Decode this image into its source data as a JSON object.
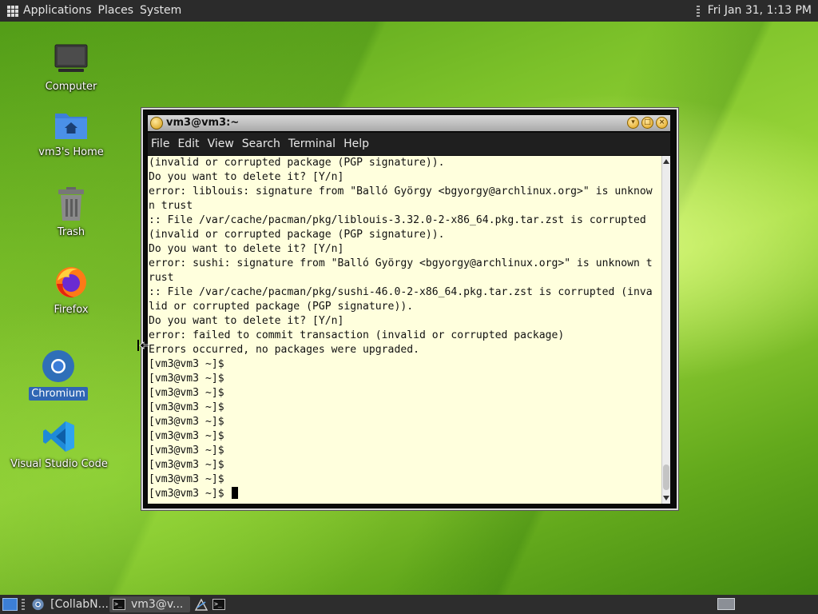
{
  "top_panel": {
    "menus": [
      "Applications",
      "Places",
      "System"
    ],
    "clock": "Fri Jan 31, 1:13 PM"
  },
  "desktop_icons": [
    {
      "label": "Computer",
      "icon": "computer-icon"
    },
    {
      "label": "vm3's Home",
      "icon": "home-folder-icon"
    },
    {
      "label": "Trash",
      "icon": "trash-icon"
    },
    {
      "label": "Firefox",
      "icon": "firefox-icon"
    },
    {
      "label": "Chromium",
      "icon": "chromium-icon",
      "selected": true
    },
    {
      "label": "Visual Studio Code",
      "icon": "vscode-icon"
    }
  ],
  "terminal": {
    "title": "vm3@vm3:~",
    "menu": [
      "File",
      "Edit",
      "View",
      "Search",
      "Terminal",
      "Help"
    ],
    "lines": [
      "(invalid or corrupted package (PGP signature)).",
      "Do you want to delete it? [Y/n]",
      "error: liblouis: signature from \"Balló György <bgyorgy@archlinux.org>\" is unknow",
      "n trust",
      ":: File /var/cache/pacman/pkg/liblouis-3.32.0-2-x86_64.pkg.tar.zst is corrupted",
      "(invalid or corrupted package (PGP signature)).",
      "Do you want to delete it? [Y/n]",
      "error: sushi: signature from \"Balló György <bgyorgy@archlinux.org>\" is unknown t",
      "rust",
      ":: File /var/cache/pacman/pkg/sushi-46.0-2-x86_64.pkg.tar.zst is corrupted (inva",
      "lid or corrupted package (PGP signature)).",
      "Do you want to delete it? [Y/n]",
      "error: failed to commit transaction (invalid or corrupted package)",
      "Errors occurred, no packages were upgraded.",
      "[vm3@vm3 ~]$",
      "[vm3@vm3 ~]$",
      "[vm3@vm3 ~]$",
      "[vm3@vm3 ~]$",
      "[vm3@vm3 ~]$",
      "[vm3@vm3 ~]$",
      "[vm3@vm3 ~]$",
      "[vm3@vm3 ~]$",
      "[vm3@vm3 ~]$",
      "[vm3@vm3 ~]$ "
    ]
  },
  "taskbar": {
    "tasks": [
      "[CollabN...",
      "vm3@v..."
    ]
  }
}
